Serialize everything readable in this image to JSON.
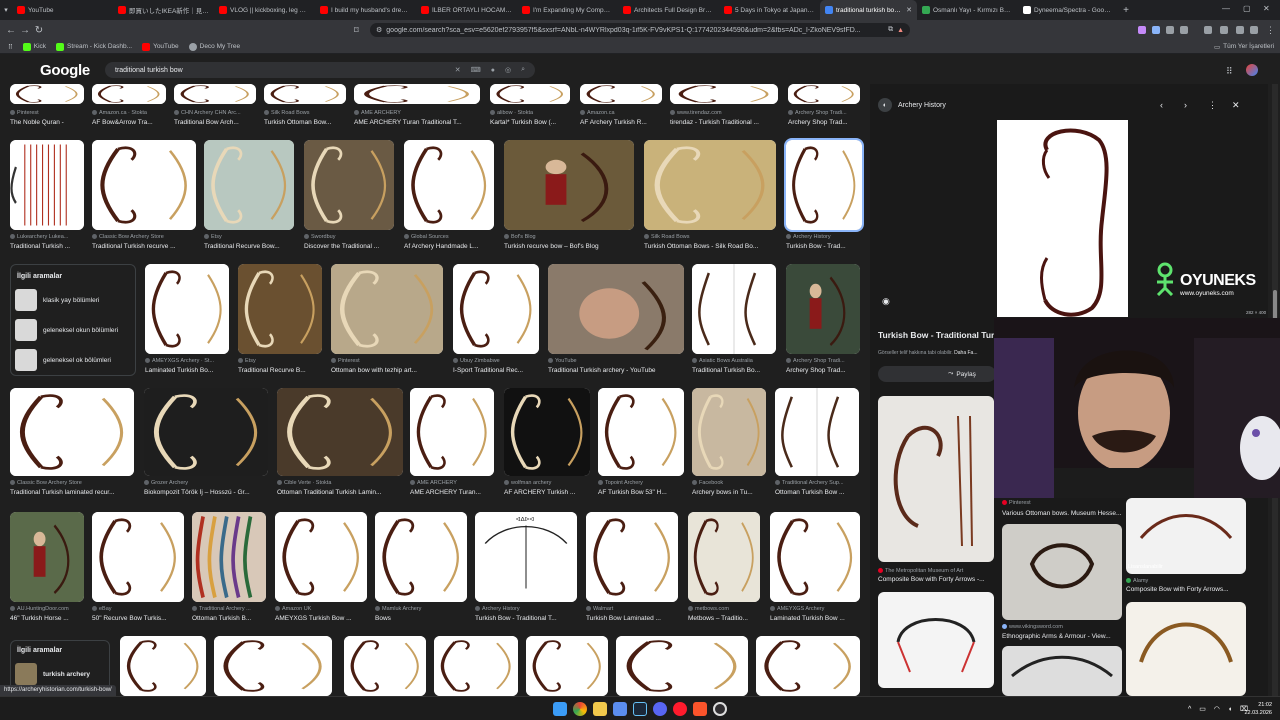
{
  "tabs": [
    {
      "title": "YouTube",
      "favicon_color": "#ff0000"
    },
    {
      "title": "即買いしたIKEA新作｜見切れ",
      "favicon_color": "#ff0000"
    },
    {
      "title": "VLOG || kickboxing, leg work",
      "favicon_color": "#ff0000"
    },
    {
      "title": "I build my husband's dream of",
      "favicon_color": "#ff0000"
    },
    {
      "title": "İLBER ORTAYLI HOCAMIZIN Gİ",
      "favicon_color": "#ff0000"
    },
    {
      "title": "I'm Expanding My Company to",
      "favicon_color": "#ff0000"
    },
    {
      "title": "Architects Full Design Breakdo",
      "favicon_color": "#ff0000"
    },
    {
      "title": "5 Days in Tokyo at Japan Travel",
      "favicon_color": "#ff0000"
    },
    {
      "title": "traditional turkish bow - G",
      "favicon_color": "#4285f4",
      "active": true
    },
    {
      "title": "Osmanlı Yayı - Kırmızı Beyaz",
      "favicon_color": "#34a853"
    },
    {
      "title": "Dyneema/Spectra - Google'da",
      "favicon_color": "#ffffff"
    }
  ],
  "url": "google.com/search?sca_esv=e5620ef2793957f5&sxsrf=ANbL-n4WYRlxpd03q-1if5K-FV9vKPS1-Q:1774202344590&udm=2&fbs=ADc_l-ZkoNEV9sfFD...",
  "bookmarks": [
    "Kick",
    "Stream - Kick Dashb...",
    "YouTube",
    "Deco My Tree"
  ],
  "bookmarks_right": "Tüm Yer İşaretleri",
  "search": {
    "logo": "Google",
    "query": "traditional turkish bow"
  },
  "results": [
    {
      "src": "Pinterest",
      "title": "The Noble Quran -",
      "pic": "bow-a"
    },
    {
      "src": "Amazon.ca · Stokta",
      "title": "AF Bow&Arrow Tra...",
      "pic": "bow-b"
    },
    {
      "src": "CHN Archery CHN Arc...",
      "title": "Traditional Bow Arch...",
      "pic": "bow-c"
    },
    {
      "src": "Silk Road Bows",
      "title": "Turkish Ottoman Bow...",
      "pic": "bow-d"
    },
    {
      "src": "AME ARCHERY",
      "title": "AME ARCHERY Turan Traditional T...",
      "pic": "bow-e"
    },
    {
      "src": "alibow · Stokta",
      "title": "Kartal* Turkish Bow (...",
      "pic": "bow-f"
    },
    {
      "src": "Amazon.ca",
      "title": "AF Archery Turkish R...",
      "pic": "bow-g"
    },
    {
      "src": "www.tirendaz.com",
      "title": "tirendaz - Turkish Traditional ...",
      "pic": "bow-h"
    },
    {
      "src": "Archery Shop Tradi...",
      "title": "Archery Shop Trad...",
      "pic": "bow-i"
    },
    {
      "src": "Lukearchery Lukea...",
      "title": "Traditional Turkish ...",
      "pic": "arrows"
    },
    {
      "src": "Classic Bow Archery Store",
      "title": "Traditional Turkish recurve ...",
      "pic": "bow-red"
    },
    {
      "src": "Etsy",
      "title": "Traditional Recurve Bow...",
      "pic": "hand"
    },
    {
      "src": "Swordbuy",
      "title": "Discover the Traditional ...",
      "pic": "ground"
    },
    {
      "src": "Global Sources",
      "title": "Af Archery Handmade L...",
      "pic": "bow-af"
    },
    {
      "src": "Bof's Blog",
      "title": "Turkish recurve bow – Bof's Blog",
      "pic": "archer"
    },
    {
      "src": "Silk Road Bows",
      "title": "Turkish Ottoman Bows - Silk Road Bo...",
      "pic": "rider"
    },
    {
      "src": "Archery History",
      "title": "Turkish Bow - Trad...",
      "pic": "bow-selected"
    },
    {
      "src": "AMEYXGS Archery · St...",
      "title": "Laminated Turkish Bo...",
      "pic": "bow-lam"
    },
    {
      "src": "Etsy",
      "title": "Traditional Recurve B...",
      "pic": "hand2"
    },
    {
      "src": "Pinterest",
      "title": "Ottoman bow with tezhip art...",
      "pic": "tezhip"
    },
    {
      "src": "Ubuy Zimbabwe",
      "title": "I-Sport Traditional Rec...",
      "pic": "bow-man"
    },
    {
      "src": "YouTube",
      "title": "Traditional Turkish archery - YouTube",
      "pic": "face"
    },
    {
      "src": "Asiatic Bows Australia",
      "title": "Traditional Turkish Bo...",
      "pic": "bows3"
    },
    {
      "src": "Archery Shop Tradi...",
      "title": "Archery Shop Trad...",
      "pic": "archer2"
    },
    {
      "src": "Classic Bow Archery Store",
      "title": "Traditional Turkish laminated recur...",
      "pic": "bow-lam2"
    },
    {
      "src": "Grozer Archery",
      "title": "Biokompozit Török Íj – Hosszú - Gr...",
      "pic": "dark-bow"
    },
    {
      "src": "Cible Verte · Stokta",
      "title": "Ottoman Traditional Turkish Lamin...",
      "pic": "leaves"
    },
    {
      "src": "AME ARCHERY",
      "title": "AME ARCHERY Turan...",
      "pic": "bow-ame"
    },
    {
      "src": "wolfman archery",
      "title": "AF ARCHERY Turkish ...",
      "pic": "dark2"
    },
    {
      "src": "Topoint Archery",
      "title": "AF Turkish Bow 53\" H...",
      "pic": "bow-af2"
    },
    {
      "src": "Facebook",
      "title": "Archery bows in Tu...",
      "pic": "wall"
    },
    {
      "src": "Traditional Archery Sup...",
      "title": "Ottoman Turkish Bow ...",
      "pic": "grid4"
    },
    {
      "src": "AU.HuntingDoor.com",
      "title": "46\" Turkish Horse ...",
      "pic": "man-stand"
    },
    {
      "src": "eBay",
      "title": "50\" Recurve Bow Turkis...",
      "pic": "bow-eb"
    },
    {
      "src": "Traditional Archery ...",
      "title": "Ottoman Turkish B...",
      "pic": "colorful"
    },
    {
      "src": "Amazon UK",
      "title": "AMEYXGS Turkish Bow ...",
      "pic": "bows-pair"
    },
    {
      "src": "Mamluk Archery",
      "title": "Bows",
      "pic": "bow-mam"
    },
    {
      "src": "Archery History",
      "title": "Turkish Bow - Traditional T...",
      "pic": "diagram"
    },
    {
      "src": "Walmart",
      "title": "Turkish Bow Laminated ...",
      "pic": "bow-wal"
    },
    {
      "src": "metbows.com",
      "title": "Metbows – Traditio...",
      "pic": "bow-met"
    },
    {
      "src": "AMEYXGS Archery",
      "title": "Laminated Turkish Bow ...",
      "pic": "bow-ame2"
    }
  ],
  "related1": {
    "heading": "İlgili aramalar",
    "items": [
      "klasik yay bölümleri",
      "geleneksel okun bölümleri",
      "geleneksel ok bölümleri"
    ]
  },
  "related2": {
    "heading": "İlgili aramalar",
    "items": [
      "turkish archery"
    ]
  },
  "panel": {
    "source": "Archery History",
    "title": "Turkish Bow - Traditional Turk...",
    "note": "Görseller telif hakkına tabi olabilir.",
    "note_link": "Daha Fa...",
    "share": "Paylaş",
    "dims": "282 × 400",
    "related": [
      {
        "src": "The Metropolitan Museum of Art",
        "title": "Composite Bow with Forty Arrows -..."
      },
      {
        "src": "Pinterest",
        "title": "Various Ottoman bows. Museum Hesse..."
      },
      {
        "src": "Alamy",
        "title": "Composite Bow with Forty Arrows..."
      },
      {
        "src": "www.vikingsword.com",
        "title": "Ethnographic Arms & Armour - View..."
      },
      {
        "src": "Lisanslanabilir",
        "title": ""
      }
    ]
  },
  "overlay": {
    "brand": "OYUNEKS",
    "sub": "www.oyuneks.com"
  },
  "status_url": "https://archeryhistorian.com/turkish-bow/",
  "clock": {
    "time": "21:02",
    "date": "22.03.2026"
  }
}
